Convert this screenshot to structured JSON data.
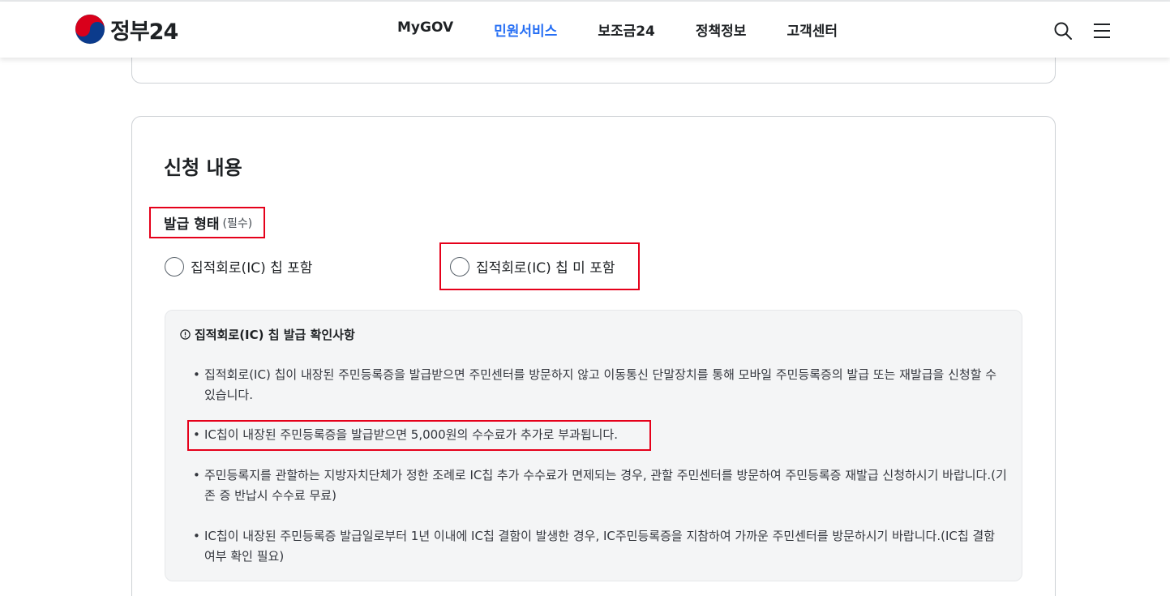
{
  "header": {
    "logo_text": "정부24",
    "nav": [
      {
        "label": "MyGOV",
        "active": false
      },
      {
        "label": "민원서비스",
        "active": true
      },
      {
        "label": "보조금24",
        "active": false
      },
      {
        "label": "정책정보",
        "active": false
      },
      {
        "label": "고객센터",
        "active": false
      }
    ],
    "icons": [
      "search-icon",
      "menu-icon"
    ]
  },
  "section": {
    "title": "신청 내용",
    "field_label": "발급 형태",
    "field_required": "(필수)",
    "options": [
      {
        "label": "집적회로(IC) 칩 포함",
        "selected": false
      },
      {
        "label": "집적회로(IC) 칩 미 포함",
        "selected": false
      }
    ]
  },
  "notice": {
    "title": "집적회로(IC) 칩 발급 확인사항",
    "items": [
      "집적회로(IC) 칩이 내장된 주민등록증을 발급받으면 주민센터를 방문하지 않고 이동통신 단말장치를 통해 모바일 주민등록증의 발급 또는 재발급을 신청할 수 있습니다.",
      "IC칩이 내장된 주민등록증을 발급받으면 5,000원의 수수료가 추가로 부과됩니다.",
      "주민등록지를 관할하는 지방자치단체가 정한 조례로 IC칩 추가 수수료가 면제되는 경우, 관할 주민센터를 방문하여 주민등록증 재발급 신청하시기 바랍니다.(기존 증 반납시 수수료 무료)",
      "IC칩이 내장된 주민등록증 발급일로부터 1년 이내에 IC칩 결함이 발생한 경우, IC주민등록증을 지참하여 가까운 주민센터를 방문하시기 바랍니다.(IC칩 결함 여부 확인 필요)"
    ]
  },
  "colors": {
    "accent": "#256ef4",
    "highlight_border": "#e5001a",
    "notice_bg": "#f4f5f6",
    "border": "#cdd1d5"
  }
}
